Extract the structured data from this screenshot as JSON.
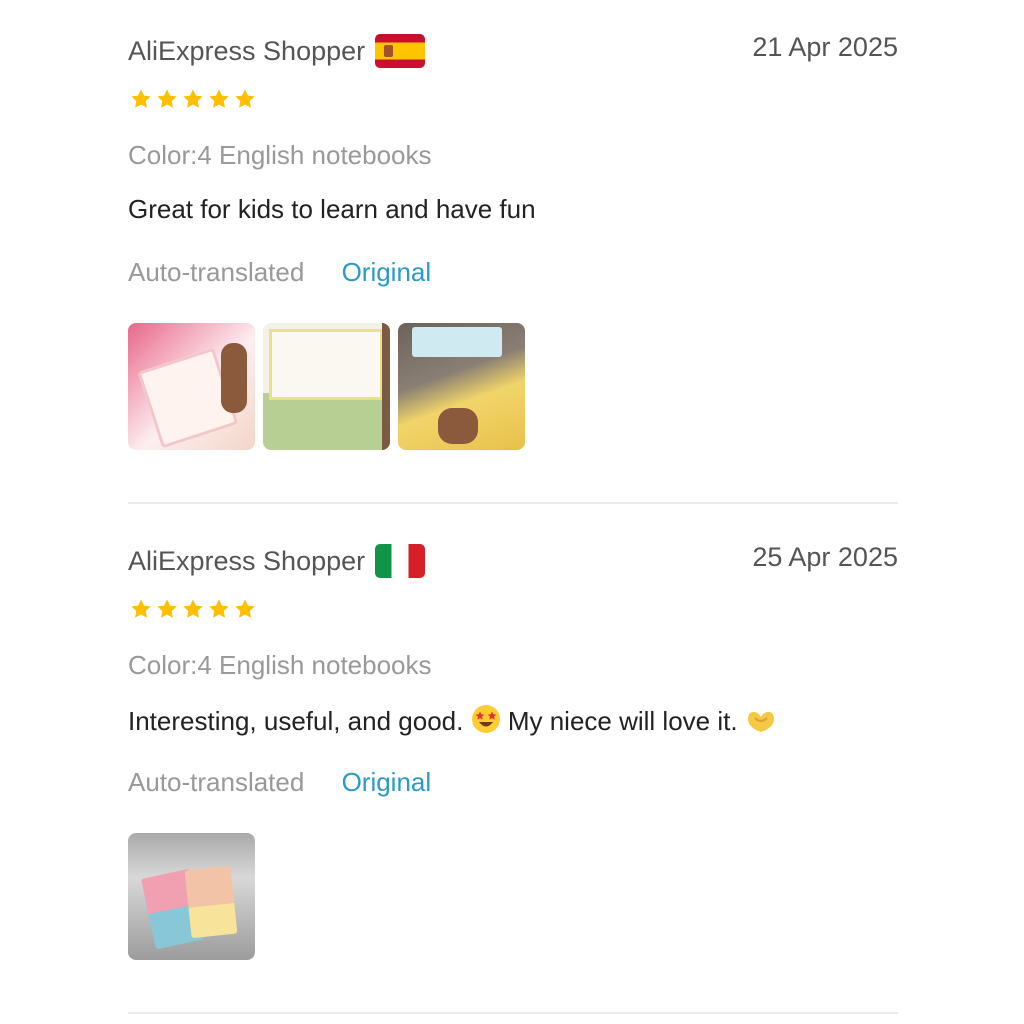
{
  "reviews": [
    {
      "author": "AliExpress Shopper",
      "country_flag": "spain-flag",
      "date": "21 Apr 2025",
      "rating": 5,
      "variant": "Color:4 English notebooks",
      "text": "Great for kids to learn and have fun",
      "auto_translated_label": "Auto-translated",
      "original_label": "Original",
      "photo_count": 3
    },
    {
      "author": "AliExpress Shopper",
      "country_flag": "italy-flag",
      "date": "25 Apr 2025",
      "rating": 5,
      "variant": "Color:4 English notebooks",
      "text_part1": "Interesting, useful, and good.",
      "emoji1": "star-struck-emoji",
      "text_part2": "My niece will love it.",
      "emoji2": "heart-hands-emoji",
      "auto_translated_label": "Auto-translated",
      "original_label": "Original",
      "photo_count": 1
    }
  ],
  "colors": {
    "star": "#ffbf00",
    "link": "#2a9ac9",
    "muted": "#999999"
  }
}
